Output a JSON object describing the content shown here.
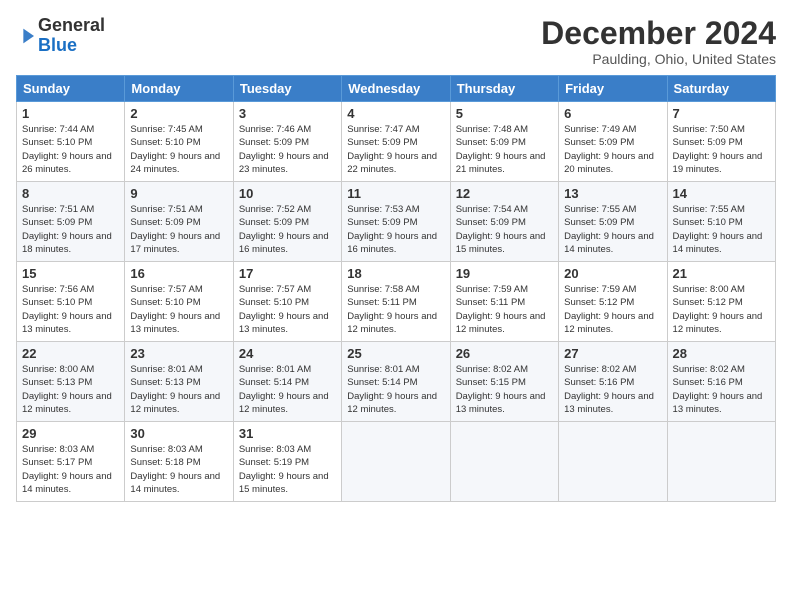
{
  "logo": {
    "line1": "General",
    "line2": "Blue"
  },
  "title": "December 2024",
  "subtitle": "Paulding, Ohio, United States",
  "weekdays": [
    "Sunday",
    "Monday",
    "Tuesday",
    "Wednesday",
    "Thursday",
    "Friday",
    "Saturday"
  ],
  "weeks": [
    [
      {
        "day": "1",
        "sunrise": "Sunrise: 7:44 AM",
        "sunset": "Sunset: 5:10 PM",
        "daylight": "Daylight: 9 hours and 26 minutes."
      },
      {
        "day": "2",
        "sunrise": "Sunrise: 7:45 AM",
        "sunset": "Sunset: 5:10 PM",
        "daylight": "Daylight: 9 hours and 24 minutes."
      },
      {
        "day": "3",
        "sunrise": "Sunrise: 7:46 AM",
        "sunset": "Sunset: 5:09 PM",
        "daylight": "Daylight: 9 hours and 23 minutes."
      },
      {
        "day": "4",
        "sunrise": "Sunrise: 7:47 AM",
        "sunset": "Sunset: 5:09 PM",
        "daylight": "Daylight: 9 hours and 22 minutes."
      },
      {
        "day": "5",
        "sunrise": "Sunrise: 7:48 AM",
        "sunset": "Sunset: 5:09 PM",
        "daylight": "Daylight: 9 hours and 21 minutes."
      },
      {
        "day": "6",
        "sunrise": "Sunrise: 7:49 AM",
        "sunset": "Sunset: 5:09 PM",
        "daylight": "Daylight: 9 hours and 20 minutes."
      },
      {
        "day": "7",
        "sunrise": "Sunrise: 7:50 AM",
        "sunset": "Sunset: 5:09 PM",
        "daylight": "Daylight: 9 hours and 19 minutes."
      }
    ],
    [
      {
        "day": "8",
        "sunrise": "Sunrise: 7:51 AM",
        "sunset": "Sunset: 5:09 PM",
        "daylight": "Daylight: 9 hours and 18 minutes."
      },
      {
        "day": "9",
        "sunrise": "Sunrise: 7:51 AM",
        "sunset": "Sunset: 5:09 PM",
        "daylight": "Daylight: 9 hours and 17 minutes."
      },
      {
        "day": "10",
        "sunrise": "Sunrise: 7:52 AM",
        "sunset": "Sunset: 5:09 PM",
        "daylight": "Daylight: 9 hours and 16 minutes."
      },
      {
        "day": "11",
        "sunrise": "Sunrise: 7:53 AM",
        "sunset": "Sunset: 5:09 PM",
        "daylight": "Daylight: 9 hours and 16 minutes."
      },
      {
        "day": "12",
        "sunrise": "Sunrise: 7:54 AM",
        "sunset": "Sunset: 5:09 PM",
        "daylight": "Daylight: 9 hours and 15 minutes."
      },
      {
        "day": "13",
        "sunrise": "Sunrise: 7:55 AM",
        "sunset": "Sunset: 5:09 PM",
        "daylight": "Daylight: 9 hours and 14 minutes."
      },
      {
        "day": "14",
        "sunrise": "Sunrise: 7:55 AM",
        "sunset": "Sunset: 5:10 PM",
        "daylight": "Daylight: 9 hours and 14 minutes."
      }
    ],
    [
      {
        "day": "15",
        "sunrise": "Sunrise: 7:56 AM",
        "sunset": "Sunset: 5:10 PM",
        "daylight": "Daylight: 9 hours and 13 minutes."
      },
      {
        "day": "16",
        "sunrise": "Sunrise: 7:57 AM",
        "sunset": "Sunset: 5:10 PM",
        "daylight": "Daylight: 9 hours and 13 minutes."
      },
      {
        "day": "17",
        "sunrise": "Sunrise: 7:57 AM",
        "sunset": "Sunset: 5:10 PM",
        "daylight": "Daylight: 9 hours and 13 minutes."
      },
      {
        "day": "18",
        "sunrise": "Sunrise: 7:58 AM",
        "sunset": "Sunset: 5:11 PM",
        "daylight": "Daylight: 9 hours and 12 minutes."
      },
      {
        "day": "19",
        "sunrise": "Sunrise: 7:59 AM",
        "sunset": "Sunset: 5:11 PM",
        "daylight": "Daylight: 9 hours and 12 minutes."
      },
      {
        "day": "20",
        "sunrise": "Sunrise: 7:59 AM",
        "sunset": "Sunset: 5:12 PM",
        "daylight": "Daylight: 9 hours and 12 minutes."
      },
      {
        "day": "21",
        "sunrise": "Sunrise: 8:00 AM",
        "sunset": "Sunset: 5:12 PM",
        "daylight": "Daylight: 9 hours and 12 minutes."
      }
    ],
    [
      {
        "day": "22",
        "sunrise": "Sunrise: 8:00 AM",
        "sunset": "Sunset: 5:13 PM",
        "daylight": "Daylight: 9 hours and 12 minutes."
      },
      {
        "day": "23",
        "sunrise": "Sunrise: 8:01 AM",
        "sunset": "Sunset: 5:13 PM",
        "daylight": "Daylight: 9 hours and 12 minutes."
      },
      {
        "day": "24",
        "sunrise": "Sunrise: 8:01 AM",
        "sunset": "Sunset: 5:14 PM",
        "daylight": "Daylight: 9 hours and 12 minutes."
      },
      {
        "day": "25",
        "sunrise": "Sunrise: 8:01 AM",
        "sunset": "Sunset: 5:14 PM",
        "daylight": "Daylight: 9 hours and 12 minutes."
      },
      {
        "day": "26",
        "sunrise": "Sunrise: 8:02 AM",
        "sunset": "Sunset: 5:15 PM",
        "daylight": "Daylight: 9 hours and 13 minutes."
      },
      {
        "day": "27",
        "sunrise": "Sunrise: 8:02 AM",
        "sunset": "Sunset: 5:16 PM",
        "daylight": "Daylight: 9 hours and 13 minutes."
      },
      {
        "day": "28",
        "sunrise": "Sunrise: 8:02 AM",
        "sunset": "Sunset: 5:16 PM",
        "daylight": "Daylight: 9 hours and 13 minutes."
      }
    ],
    [
      {
        "day": "29",
        "sunrise": "Sunrise: 8:03 AM",
        "sunset": "Sunset: 5:17 PM",
        "daylight": "Daylight: 9 hours and 14 minutes."
      },
      {
        "day": "30",
        "sunrise": "Sunrise: 8:03 AM",
        "sunset": "Sunset: 5:18 PM",
        "daylight": "Daylight: 9 hours and 14 minutes."
      },
      {
        "day": "31",
        "sunrise": "Sunrise: 8:03 AM",
        "sunset": "Sunset: 5:19 PM",
        "daylight": "Daylight: 9 hours and 15 minutes."
      },
      null,
      null,
      null,
      null
    ]
  ]
}
